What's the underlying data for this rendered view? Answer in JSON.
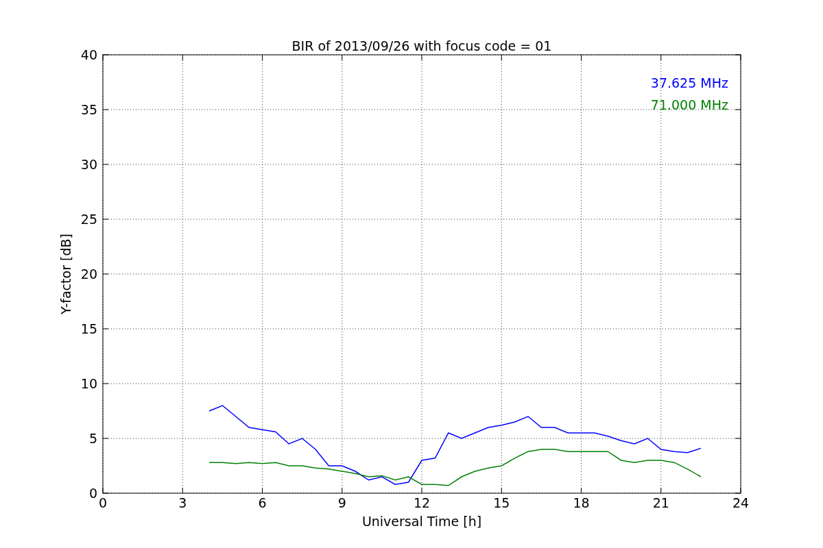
{
  "chart_data": {
    "type": "line",
    "title": "BIR of 2013/09/26 with focus code = 01",
    "xlabel": "Universal Time [h]",
    "ylabel": "Y-factor [dB]",
    "x": [
      4.0,
      4.5,
      5.0,
      5.5,
      6.0,
      6.5,
      7.0,
      7.5,
      8.0,
      8.5,
      9.0,
      9.5,
      10.0,
      10.5,
      11.0,
      11.5,
      12.0,
      12.5,
      13.0,
      13.5,
      14.0,
      14.5,
      15.0,
      15.5,
      16.0,
      16.5,
      17.0,
      17.5,
      18.0,
      18.5,
      19.0,
      19.5,
      20.0,
      20.5,
      21.0,
      21.5,
      22.0,
      22.5
    ],
    "series": [
      {
        "name": "37.625 MHz",
        "color": "#0000ff",
        "values": [
          7.5,
          8.0,
          7.0,
          6.0,
          5.8,
          5.6,
          4.5,
          5.0,
          4.0,
          2.5,
          2.5,
          2.0,
          1.2,
          1.5,
          0.8,
          1.0,
          3.0,
          3.2,
          5.5,
          5.0,
          5.5,
          6.0,
          6.2,
          6.5,
          7.0,
          6.0,
          6.0,
          5.5,
          5.5,
          5.5,
          5.2,
          4.8,
          4.5,
          5.0,
          4.0,
          3.8,
          3.7,
          4.1
        ]
      },
      {
        "name": "71.000 MHz",
        "color": "#008000",
        "values": [
          2.8,
          2.8,
          2.7,
          2.8,
          2.7,
          2.8,
          2.5,
          2.5,
          2.3,
          2.2,
          2.0,
          1.8,
          1.5,
          1.6,
          1.2,
          1.5,
          0.8,
          0.8,
          0.7,
          1.5,
          2.0,
          2.3,
          2.5,
          3.2,
          3.8,
          4.0,
          4.0,
          3.8,
          3.8,
          3.8,
          3.8,
          3.0,
          2.8,
          3.0,
          3.0,
          2.8,
          2.2,
          1.5
        ]
      }
    ],
    "xlim": [
      0,
      24
    ],
    "ylim": [
      0,
      40
    ],
    "xticks": [
      0,
      3,
      6,
      9,
      12,
      15,
      18,
      21,
      24
    ],
    "yticks": [
      0,
      5,
      10,
      15,
      20,
      25,
      30,
      35,
      40
    ],
    "grid": true
  }
}
